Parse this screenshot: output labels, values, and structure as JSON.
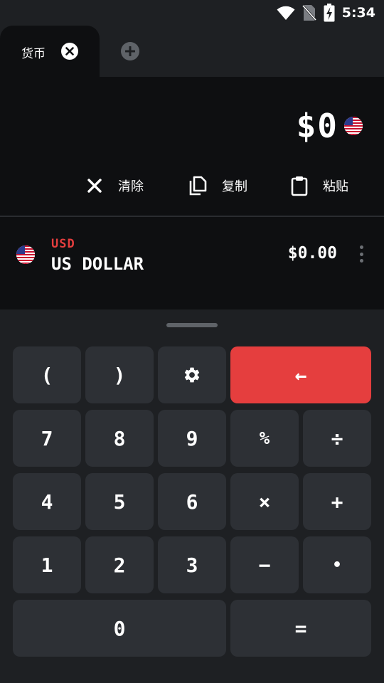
{
  "status_bar": {
    "time": "5:34"
  },
  "tabs": [
    {
      "label": "货币"
    }
  ],
  "display": {
    "amount": "$0"
  },
  "actions": {
    "clear_label": "清除",
    "copy_label": "复制",
    "paste_label": "粘贴"
  },
  "currencies": [
    {
      "code": "USD",
      "name": "US DOLLAR",
      "value": "$0.00"
    }
  ],
  "keypad": {
    "open_paren": "(",
    "close_paren": ")",
    "backspace": "←",
    "k7": "7",
    "k8": "8",
    "k9": "9",
    "percent": "%",
    "divide": "÷",
    "k4": "4",
    "k5": "5",
    "k6": "6",
    "multiply": "×",
    "plus": "+",
    "k1": "1",
    "k2": "2",
    "k3": "3",
    "minus": "−",
    "dot": "•",
    "k0": "0",
    "equals": "="
  },
  "colors": {
    "accent_red": "#e53e3e",
    "key_bg": "#2d3035",
    "display_bg": "#0e0f11",
    "app_bg": "#1e2023"
  },
  "icons": {
    "wifi": "wifi-icon",
    "no_sim": "no-sim-icon",
    "battery": "battery-charging-icon",
    "close_tab": "close-circle-icon",
    "add_tab": "add-circle-icon",
    "clear": "close-icon",
    "copy": "copy-icon",
    "paste": "clipboard-icon",
    "flag": "us-flag-icon",
    "menu": "more-vert-icon",
    "settings": "gear-icon"
  }
}
